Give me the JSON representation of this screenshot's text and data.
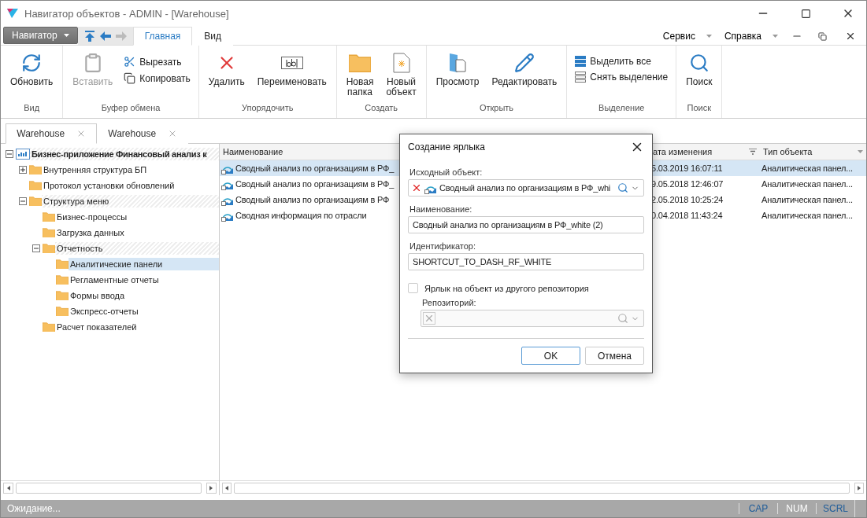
{
  "window": {
    "title": "Навигатор объектов - ADMIN - [Warehouse]"
  },
  "navigator_button": {
    "label": "Навигатор"
  },
  "ribbon_tabs": [
    {
      "label": "Главная",
      "selected": true
    },
    {
      "label": "Вид",
      "selected": false
    }
  ],
  "menu": [
    "Сервис",
    "Справка"
  ],
  "ribbon_groups": [
    {
      "label": "Вид",
      "buttons": [
        {
          "label": "Обновить",
          "kind": "large",
          "disabled": false
        }
      ]
    },
    {
      "label": "Буфер обмена",
      "buttons": [
        {
          "label": "Вставить",
          "kind": "large",
          "disabled": true
        },
        {
          "label": "Вырезать",
          "kind": "small",
          "disabled": false
        },
        {
          "label": "Копировать",
          "kind": "small",
          "disabled": false
        }
      ]
    },
    {
      "label": "Упорядочить",
      "buttons": [
        {
          "label": "Удалить",
          "kind": "large",
          "disabled": false
        },
        {
          "label": "Переименовать",
          "kind": "large",
          "disabled": false
        }
      ]
    },
    {
      "label": "Создать",
      "buttons": [
        {
          "label": "Новая папка",
          "kind": "large",
          "disabled": false
        },
        {
          "label": "Новый объект",
          "kind": "large",
          "disabled": false
        }
      ]
    },
    {
      "label": "Открыть",
      "buttons": [
        {
          "label": "Просмотр",
          "kind": "large",
          "disabled": false
        },
        {
          "label": "Редактировать",
          "kind": "large",
          "disabled": false
        }
      ]
    },
    {
      "label": "Выделение",
      "buttons": [
        {
          "label": "Выделить все",
          "kind": "small",
          "disabled": false
        },
        {
          "label": "Снять выделение",
          "kind": "small",
          "disabled": false
        }
      ]
    },
    {
      "label": "Поиск",
      "buttons": [
        {
          "label": "Поиск",
          "kind": "large",
          "disabled": false
        }
      ]
    }
  ],
  "document_tabs": [
    {
      "label": "Warehouse",
      "selected": true
    },
    {
      "label": "Warehouse",
      "selected": false
    }
  ],
  "tree": [
    {
      "label": "Бизнес-приложение Финансовый анализ к",
      "kind": "root",
      "expanded": true,
      "highlighted": true,
      "selected": false,
      "children": [
        {
          "label": "Внутренняя структура БП",
          "expanded": false,
          "highlighted": false,
          "selected": false
        },
        {
          "label": "Протокол установки обновлений",
          "highlighted": false,
          "selected": false
        },
        {
          "label": "Структура меню",
          "expanded": true,
          "highlighted": true,
          "selected": false,
          "children": [
            {
              "label": "Бизнес-процессы",
              "highlighted": false,
              "selected": false
            },
            {
              "label": "Загрузка данных",
              "highlighted": false,
              "selected": false
            },
            {
              "label": "Отчетность",
              "expanded": true,
              "highlighted": true,
              "selected": false,
              "children": [
                {
                  "label": "Аналитические панели",
                  "highlighted": false,
                  "selected": true
                },
                {
                  "label": "Регламентные отчеты",
                  "highlighted": false,
                  "selected": false
                },
                {
                  "label": "Формы ввода",
                  "highlighted": false,
                  "selected": false
                },
                {
                  "label": "Экспресс-отчеты",
                  "highlighted": false,
                  "selected": false
                }
              ]
            },
            {
              "label": "Расчет показателей",
              "highlighted": false,
              "selected": false
            }
          ]
        }
      ]
    }
  ],
  "table": {
    "columns": [
      "Наименование",
      "ата изменения",
      "Тип объекта"
    ],
    "rows": [
      {
        "name": "Сводный анализ по организациям в РФ_",
        "date": "5.03.2019 16:07:11",
        "type": "Аналитическая панел...",
        "selected": true
      },
      {
        "name": "Сводный анализ по организациям в РФ_",
        "date": "9.05.2018 12:46:07",
        "type": "Аналитическая панел...",
        "selected": false
      },
      {
        "name": "Сводный анализ по организациям в РФ",
        "date": "2.05.2018 10:25:24",
        "type": "Аналитическая панел...",
        "selected": false
      },
      {
        "name": "Сводная информация по отрасли",
        "date": "0.04.2018 11:43:24",
        "type": "Аналитическая панел...",
        "selected": false
      }
    ]
  },
  "dialog": {
    "title": "Создание ярлыка",
    "source": {
      "label": "Исходный объект:",
      "value": "Сводный анализ по организациям в РФ_whi"
    },
    "name": {
      "label": "Наименование:",
      "value": "Сводный анализ по организациям в РФ_white (2)"
    },
    "identifier": {
      "label": "Идентификатор:",
      "value": "SHORTCUT_TO_DASH_RF_WHITE"
    },
    "other_repo": {
      "label": "Ярлык на объект из другого репозитория",
      "checked": false
    },
    "repository": {
      "label": "Репозиторий:",
      "disabled": true
    },
    "buttons": [
      "OK",
      "Отмена"
    ]
  },
  "status_bar": {
    "text": "Ожидание...",
    "indicators": [
      {
        "label": "CAP",
        "on": false
      },
      {
        "label": "NUM",
        "on": true
      },
      {
        "label": "SCRL",
        "on": false
      }
    ]
  }
}
